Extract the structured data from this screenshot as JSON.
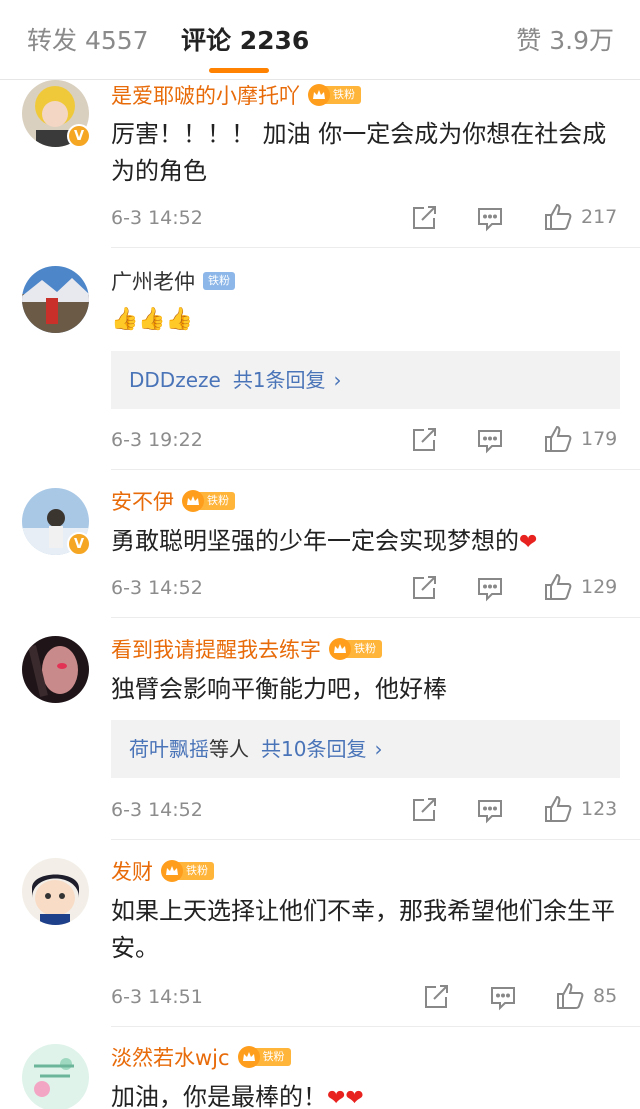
{
  "tabs": {
    "repost": "转发 4557",
    "comments": "评论 2236",
    "likes": "赞 3.9万"
  },
  "comments": [
    {
      "username": "是爱耶啵的小摩托吖",
      "fan_badge": "铁粉",
      "text": "厉害！！！！ 加油 你一定会成为你想在社会成为的角色",
      "time": "6-3 14:52",
      "likes": "217"
    },
    {
      "username": "广州老仲",
      "fan_badge": "铁粉",
      "text": "👍👍👍",
      "reply_user": "DDDzeze",
      "reply_count": "共1条回复",
      "time": "6-3 19:22",
      "likes": "179"
    },
    {
      "username": "安不伊",
      "fan_badge": "铁粉",
      "text": "勇敢聪明坚强的少年一定会实现梦想的",
      "time": "6-3 14:52",
      "likes": "129"
    },
    {
      "username": "看到我请提醒我去练字",
      "fan_badge": "铁粉",
      "text": "独臂会影响平衡能力吧，他好棒",
      "reply_user": "荷叶飘摇",
      "reply_others": "等人",
      "reply_count": "共10条回复",
      "time": "6-3 14:52",
      "likes": "123"
    },
    {
      "username": "发财",
      "fan_badge": "铁粉",
      "text": "如果上天选择让他们不幸，那我希望他们余生平安。",
      "time": "6-3 14:51",
      "likes": "85"
    },
    {
      "username": "淡然若水wjc",
      "fan_badge": "铁粉",
      "text": "加油，你是最棒的！"
    }
  ],
  "colors": {
    "accent": "#ff8200",
    "username_fan": "#e86b0a",
    "reply_link": "#4a74b8",
    "heart": "#e8231f"
  },
  "icons": [
    "repost-icon",
    "comment-icon",
    "like-icon",
    "crown-icon",
    "verified-icon",
    "chevron-right-icon",
    "heart-icon"
  ]
}
